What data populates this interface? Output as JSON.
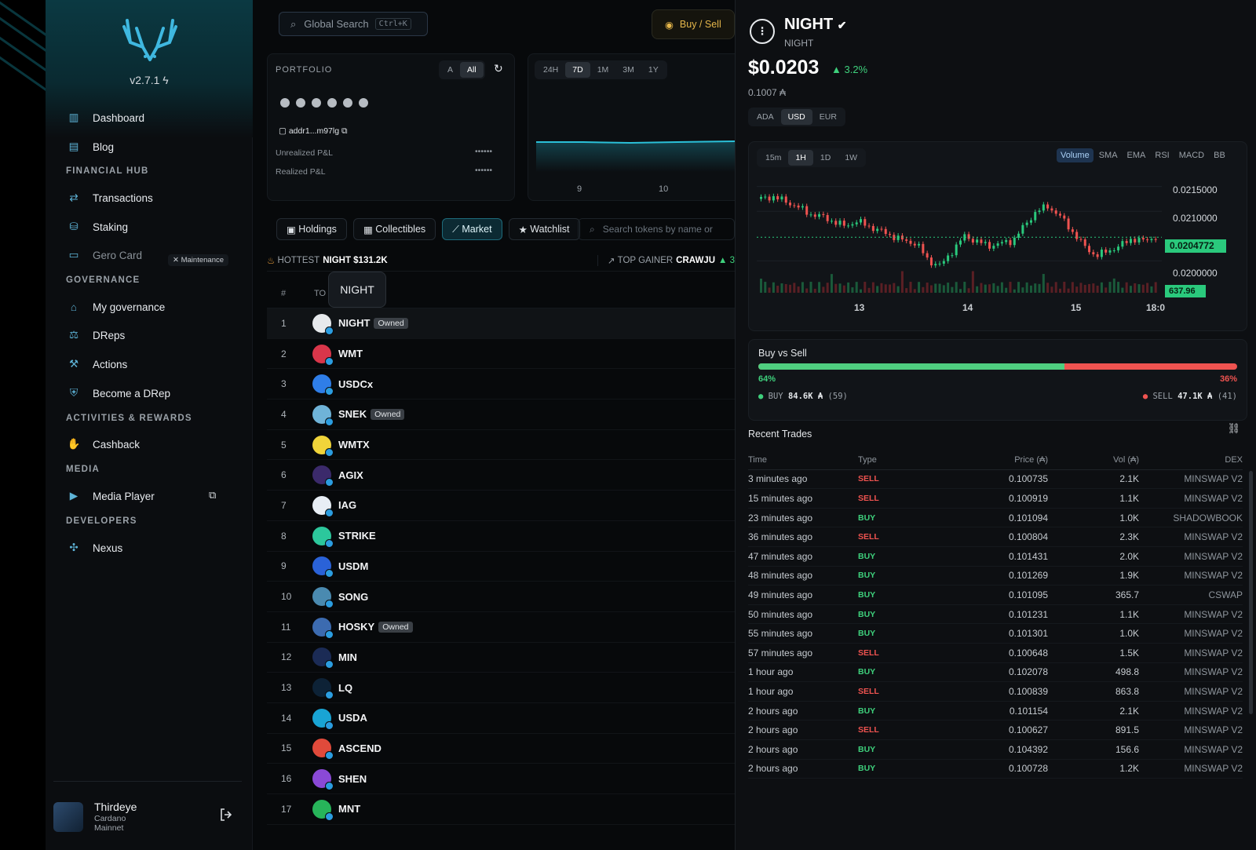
{
  "sidebar": {
    "version": "v2.7.1",
    "items": {
      "dashboard": "Dashboard",
      "blog": "Blog",
      "transactions": "Transactions",
      "staking": "Staking",
      "gero_card": "Gero Card",
      "maintenance": "Maintenance",
      "my_governance": "My governance",
      "dreps": "DReps",
      "actions": "Actions",
      "become_drep": "Become a DRep",
      "cashback": "Cashback",
      "media_player": "Media Player",
      "nexus": "Nexus"
    },
    "sections": {
      "financial": "FINANCIAL HUB",
      "governance": "GOVERNANCE",
      "activities": "ACTIVITIES & REWARDS",
      "media": "MEDIA",
      "developers": "DEVELOPERS"
    },
    "user": {
      "name": "Thirdeye",
      "network": "Cardano",
      "net2": "Mainnet"
    }
  },
  "topbar": {
    "search_placeholder": "Global Search",
    "search_kbd": "Ctrl+K",
    "buy_sell": "Buy / Sell"
  },
  "portfolio": {
    "title": "PORTFOLIO",
    "toggle": [
      "A",
      "All"
    ],
    "address": "addr1...m97lg",
    "unrealized": "Unrealized P&L",
    "realized": "Realized P&L",
    "masked": "••••••",
    "ranges": [
      "24H",
      "7D",
      "1M",
      "3M",
      "1Y"
    ],
    "x_ticks": [
      "9",
      "10"
    ]
  },
  "tabs": {
    "holdings": "Holdings",
    "collectibles": "Collectibles",
    "market": "Market",
    "watchlist": "Watchlist",
    "search_placeholder": "Search tokens by name or"
  },
  "ticker": {
    "hottest_label": "HOTTEST",
    "hottest_token": "NIGHT $131.2K",
    "gainer_label": "TOP GAINER",
    "gainer_token": "CRAWJU",
    "gainer_val": "▲ 3"
  },
  "table": {
    "col_num": "#",
    "col_token": "TO",
    "tooltip": "NIGHT",
    "owned": "Owned",
    "rows": [
      {
        "n": "1",
        "name": "NIGHT",
        "owned": true,
        "color": "#e6e9ec"
      },
      {
        "n": "2",
        "name": "WMT",
        "owned": false,
        "color": "#d9364a"
      },
      {
        "n": "3",
        "name": "USDCx",
        "owned": false,
        "color": "#2f7ee8"
      },
      {
        "n": "4",
        "name": "SNEK",
        "owned": true,
        "color": "#6fb3d8"
      },
      {
        "n": "5",
        "name": "WMTX",
        "owned": false,
        "color": "#f0d43a"
      },
      {
        "n": "6",
        "name": "AGIX",
        "owned": false,
        "color": "#3b2a6b"
      },
      {
        "n": "7",
        "name": "IAG",
        "owned": false,
        "color": "#e8eef5"
      },
      {
        "n": "8",
        "name": "STRIKE",
        "owned": false,
        "color": "#2cc79c"
      },
      {
        "n": "9",
        "name": "USDM",
        "owned": false,
        "color": "#2a62d8"
      },
      {
        "n": "10",
        "name": "SONG",
        "owned": false,
        "color": "#4a8ab0"
      },
      {
        "n": "11",
        "name": "HOSKY",
        "owned": true,
        "color": "#3c6bb0"
      },
      {
        "n": "12",
        "name": "MIN",
        "owned": false,
        "color": "#1b2b55"
      },
      {
        "n": "13",
        "name": "LQ",
        "owned": false,
        "color": "#0d2236"
      },
      {
        "n": "14",
        "name": "USDA",
        "owned": false,
        "color": "#19a4d4"
      },
      {
        "n": "15",
        "name": "ASCEND",
        "owned": false,
        "color": "#e04a3b"
      },
      {
        "n": "16",
        "name": "SHEN",
        "owned": false,
        "color": "#8a49d6"
      },
      {
        "n": "17",
        "name": "MNT",
        "owned": false,
        "color": "#27b45a"
      }
    ]
  },
  "token": {
    "name": "NIGHT",
    "ticker": "NIGHT",
    "price": "$0.0203",
    "change": "▲ 3.2%",
    "ada_price": "0.1007 ₳",
    "currencies": [
      "ADA",
      "USD",
      "EUR"
    ],
    "selected_currency": "USD"
  },
  "chart": {
    "intervals": [
      "15m",
      "1H",
      "1D",
      "1W"
    ],
    "selected_interval": "1H",
    "indicators": [
      "Volume",
      "SMA",
      "EMA",
      "RSI",
      "MACD",
      "BB"
    ],
    "y_ticks": [
      "0.0215000",
      "0.0210000",
      "0.0200000"
    ],
    "x_ticks": [
      "13",
      "14",
      "15",
      "18:0"
    ],
    "last_price": "0.0204772",
    "last_volume": "637.96"
  },
  "chart_data": {
    "type": "line",
    "title": "",
    "x": [
      "13",
      "14",
      "15",
      "18:0"
    ],
    "ylim": [
      0.0198,
      0.0217
    ],
    "y_ticks": [
      0.0215,
      0.021,
      0.02
    ],
    "last_price": 0.0204772,
    "last_volume": 637.96
  },
  "buy_vs_sell": {
    "title": "Buy vs Sell",
    "buy_pct": 64,
    "sell_pct": 36,
    "buy_pct_label": "64%",
    "sell_pct_label": "36%",
    "buy_label": "BUY",
    "buy_val": "84.6K ₳",
    "buy_count": "(59)",
    "sell_label": "SELL",
    "sell_val": "47.1K ₳",
    "sell_count": "(41)"
  },
  "recent_trades": {
    "title": "Recent Trades",
    "headers": [
      "Time",
      "Type",
      "Price (₳)",
      "Vol (₳)",
      "DEX"
    ],
    "rows": [
      [
        "3 minutes ago",
        "SELL",
        "0.100735",
        "2.1K",
        "MINSWAP V2"
      ],
      [
        "15 minutes ago",
        "SELL",
        "0.100919",
        "1.1K",
        "MINSWAP V2"
      ],
      [
        "23 minutes ago",
        "BUY",
        "0.101094",
        "1.0K",
        "SHADOWBOOK"
      ],
      [
        "36 minutes ago",
        "SELL",
        "0.100804",
        "2.3K",
        "MINSWAP V2"
      ],
      [
        "47 minutes ago",
        "BUY",
        "0.101431",
        "2.0K",
        "MINSWAP V2"
      ],
      [
        "48 minutes ago",
        "BUY",
        "0.101269",
        "1.9K",
        "MINSWAP V2"
      ],
      [
        "49 minutes ago",
        "BUY",
        "0.101095",
        "365.7",
        "CSWAP"
      ],
      [
        "50 minutes ago",
        "BUY",
        "0.101231",
        "1.1K",
        "MINSWAP V2"
      ],
      [
        "55 minutes ago",
        "BUY",
        "0.101301",
        "1.0K",
        "MINSWAP V2"
      ],
      [
        "57 minutes ago",
        "SELL",
        "0.100648",
        "1.5K",
        "MINSWAP V2"
      ],
      [
        "1 hour ago",
        "BUY",
        "0.102078",
        "498.8",
        "MINSWAP V2"
      ],
      [
        "1 hour ago",
        "SELL",
        "0.100839",
        "863.8",
        "MINSWAP V2"
      ],
      [
        "2 hours ago",
        "BUY",
        "0.101154",
        "2.1K",
        "MINSWAP V2"
      ],
      [
        "2 hours ago",
        "SELL",
        "0.100627",
        "891.5",
        "MINSWAP V2"
      ],
      [
        "2 hours ago",
        "BUY",
        "0.104392",
        "156.6",
        "MINSWAP V2"
      ],
      [
        "2 hours ago",
        "BUY",
        "0.100728",
        "1.2K",
        "MINSWAP V2"
      ]
    ]
  },
  "colors": {
    "buy": "#3ed07c",
    "sell": "#ef5350",
    "accent": "#1e9fb5"
  }
}
